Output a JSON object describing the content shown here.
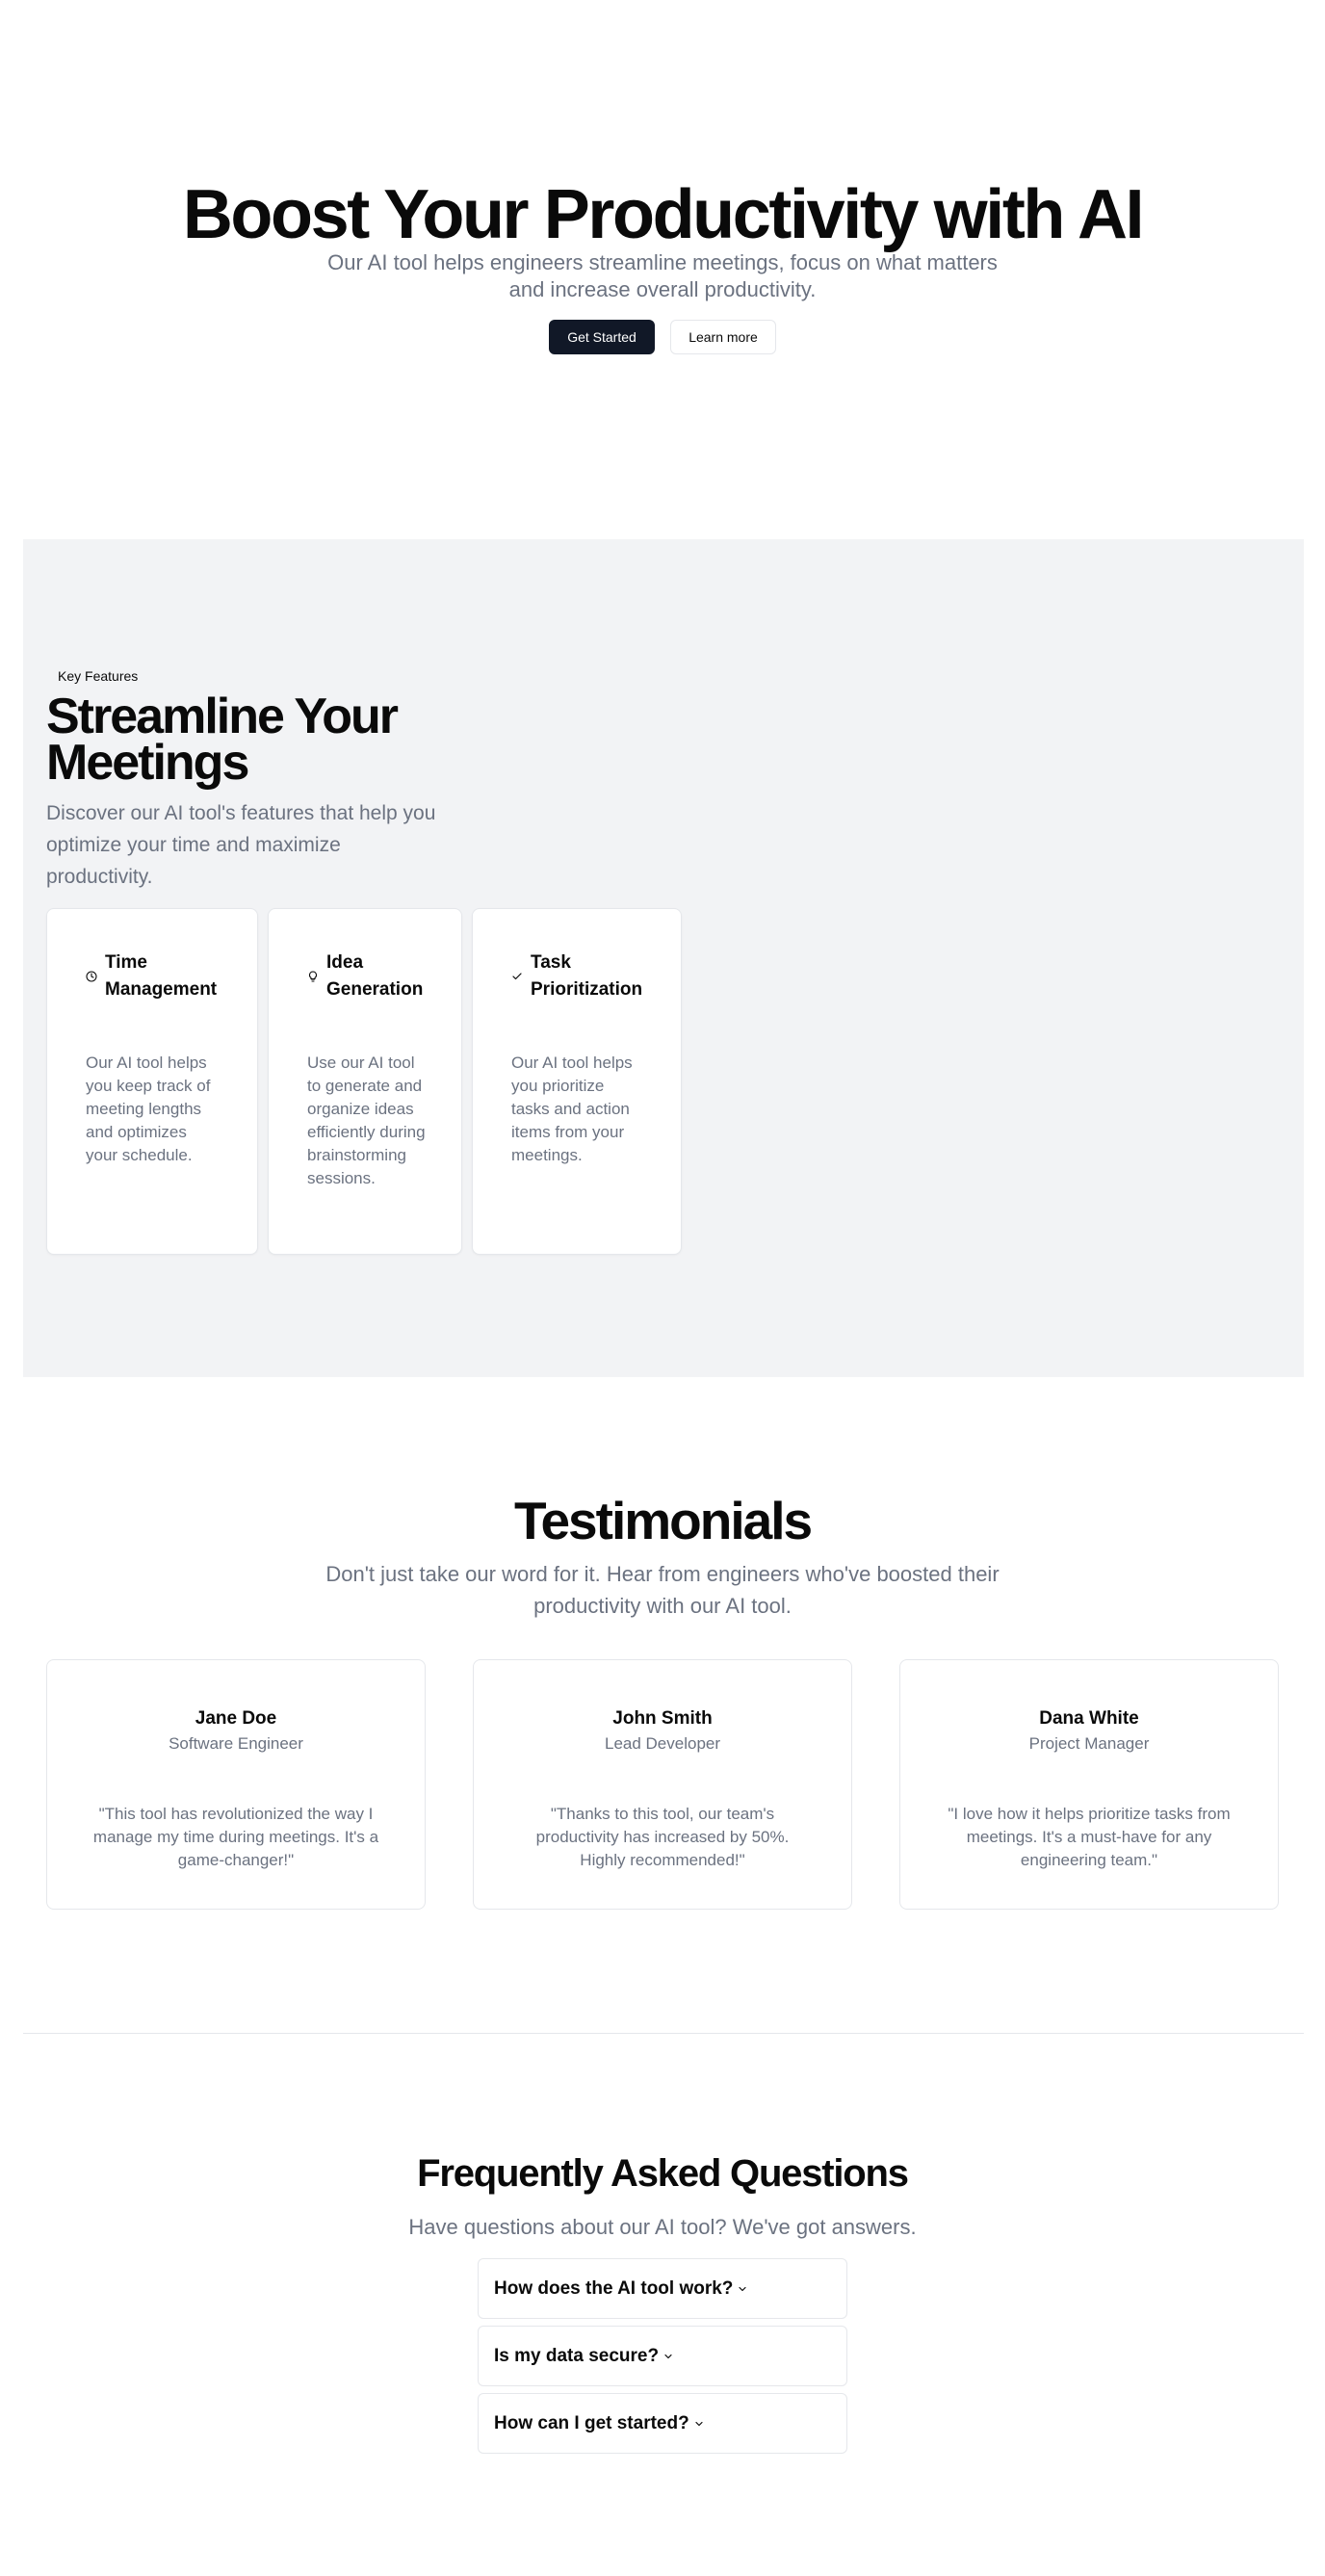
{
  "hero": {
    "title": "Boost Your Productivity with AI",
    "subtitle": "Our AI tool helps engineers streamline meetings, focus on what matters and increase overall productivity.",
    "primary_button": "Get Started",
    "secondary_button": "Learn more"
  },
  "features": {
    "badge": "Key Features",
    "title": "Streamline Your Meetings",
    "subtitle": "Discover our AI tool's features that help you optimize your time and maximize productivity.",
    "cards": [
      {
        "icon": "clock-icon",
        "title": "Time Management",
        "description": "Our AI tool helps you keep track of meeting lengths and optimizes your schedule."
      },
      {
        "icon": "lightbulb-icon",
        "title": "Idea Generation",
        "description": "Use our AI tool to generate and organize ideas efficiently during brainstorming sessions."
      },
      {
        "icon": "check-icon",
        "title": "Task Prioritization",
        "description": "Our AI tool helps you prioritize tasks and action items from your meetings."
      }
    ]
  },
  "testimonials": {
    "title": "Testimonials",
    "subtitle": "Don't just take our word for it. Hear from engineers who've boosted their productivity with our AI tool.",
    "items": [
      {
        "name": "Jane Doe",
        "role": "Software Engineer",
        "quote": "\"This tool has revolutionized the way I manage my time during meetings. It's a game-changer!\""
      },
      {
        "name": "John Smith",
        "role": "Lead Developer",
        "quote": "\"Thanks to this tool, our team's productivity has increased by 50%. Highly recommended!\""
      },
      {
        "name": "Dana White",
        "role": "Project Manager",
        "quote": "\"I love how it helps prioritize tasks from meetings. It's a must-have for any engineering team.\""
      }
    ]
  },
  "faq": {
    "title": "Frequently Asked Questions",
    "subtitle": "Have questions about our AI tool? We've got answers.",
    "items": [
      {
        "question": "How does the AI tool work?"
      },
      {
        "question": "Is my data secure?"
      },
      {
        "question": "How can I get started?"
      }
    ]
  },
  "colors": {
    "primary": "#111827",
    "muted_text": "#6b7280",
    "section_bg": "#f2f3f5",
    "border": "#e5e7eb"
  }
}
